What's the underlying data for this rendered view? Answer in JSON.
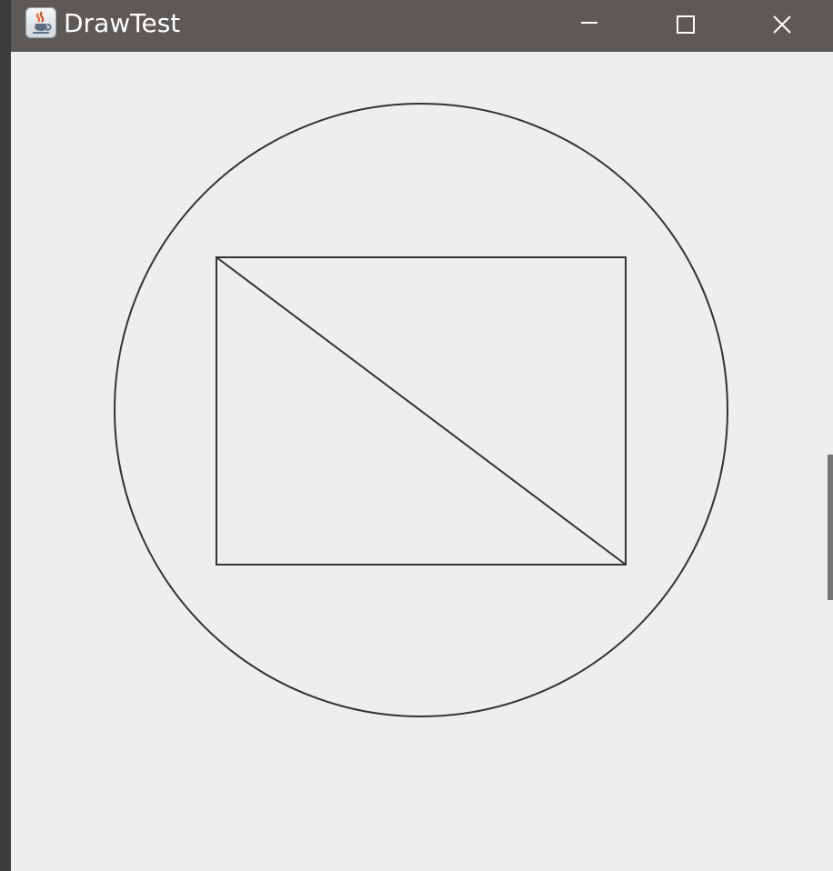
{
  "window": {
    "title": "DrawTest",
    "icons": {
      "app": "java-coffee-icon",
      "minimize": "minimize-icon",
      "maximize": "maximize-icon",
      "close": "close-icon"
    },
    "colors": {
      "titlebar": "#5d5957",
      "client_background": "#eeeeee",
      "drawing_stroke": "#333333"
    }
  },
  "drawing": {
    "shapes": [
      "circle",
      "rectangle",
      "diagonal-line"
    ]
  }
}
